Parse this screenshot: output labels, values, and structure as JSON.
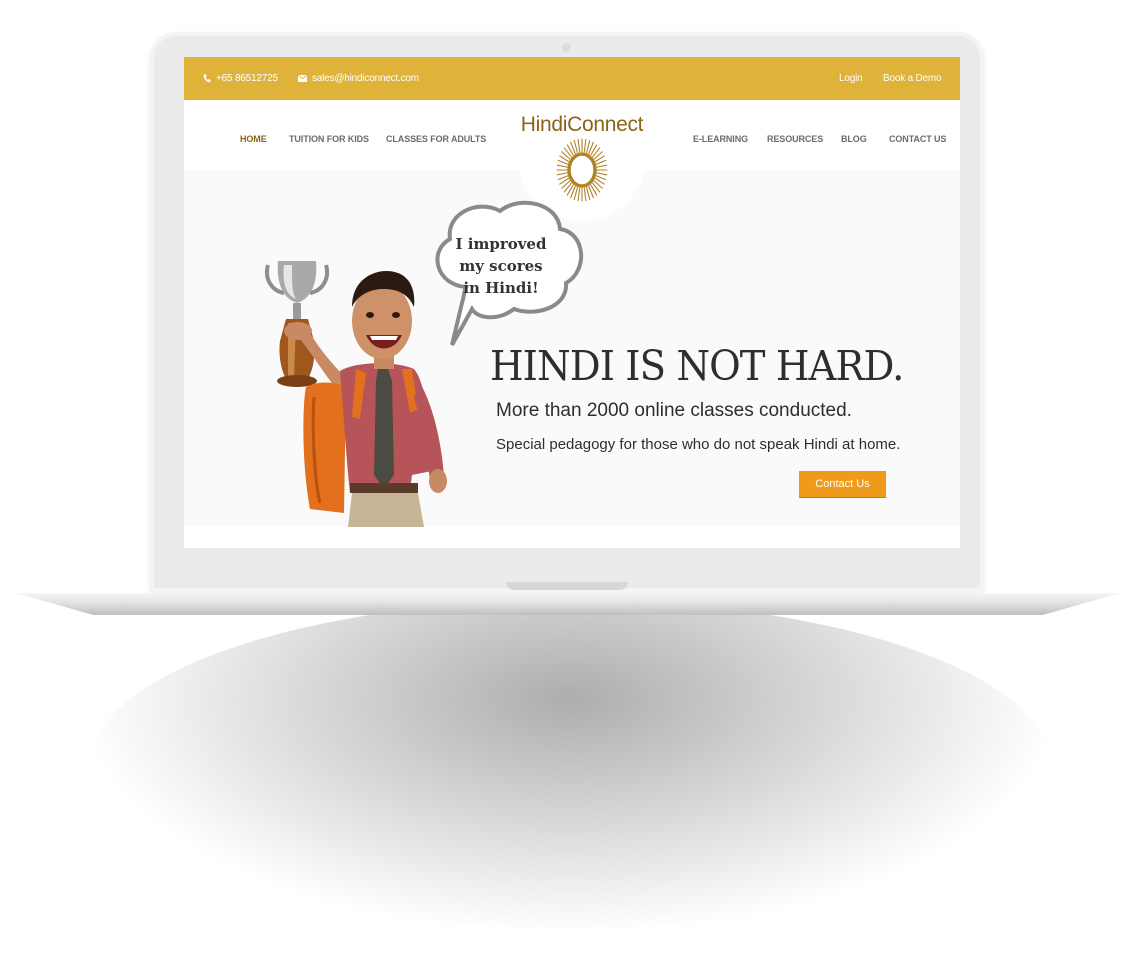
{
  "topbar": {
    "phone": "+65 86512725",
    "email": "sales@hindiconnect.com",
    "login": "Login",
    "book_demo": "Book a Demo",
    "phone_icon": "phone-icon",
    "email_icon": "envelope-icon"
  },
  "nav": {
    "left": [
      {
        "label": "HOME",
        "active": true
      },
      {
        "label": "TUITION FOR KIDS"
      },
      {
        "label": "CLASSES FOR ADULTS"
      }
    ],
    "right": [
      {
        "label": "E-LEARNING"
      },
      {
        "label": "RESOURCES"
      },
      {
        "label": "BLOG"
      },
      {
        "label": "CONTACT US"
      }
    ]
  },
  "logo": {
    "text": "HindiConnect",
    "icon": "sun-icon"
  },
  "hero": {
    "bubble_lines": [
      "I improved",
      "my scores",
      "in Hindi!"
    ],
    "headline": "HINDI IS NOT HARD.",
    "subline": "More than 2000 online classes conducted.",
    "tagline": "Special pedagogy for those who do not speak Hindi at home.",
    "cta": "Contact Us"
  },
  "colors": {
    "topbar": "#dfb33a",
    "brand_brown": "#8a6418",
    "cta_orange": "#ef9a1a"
  }
}
